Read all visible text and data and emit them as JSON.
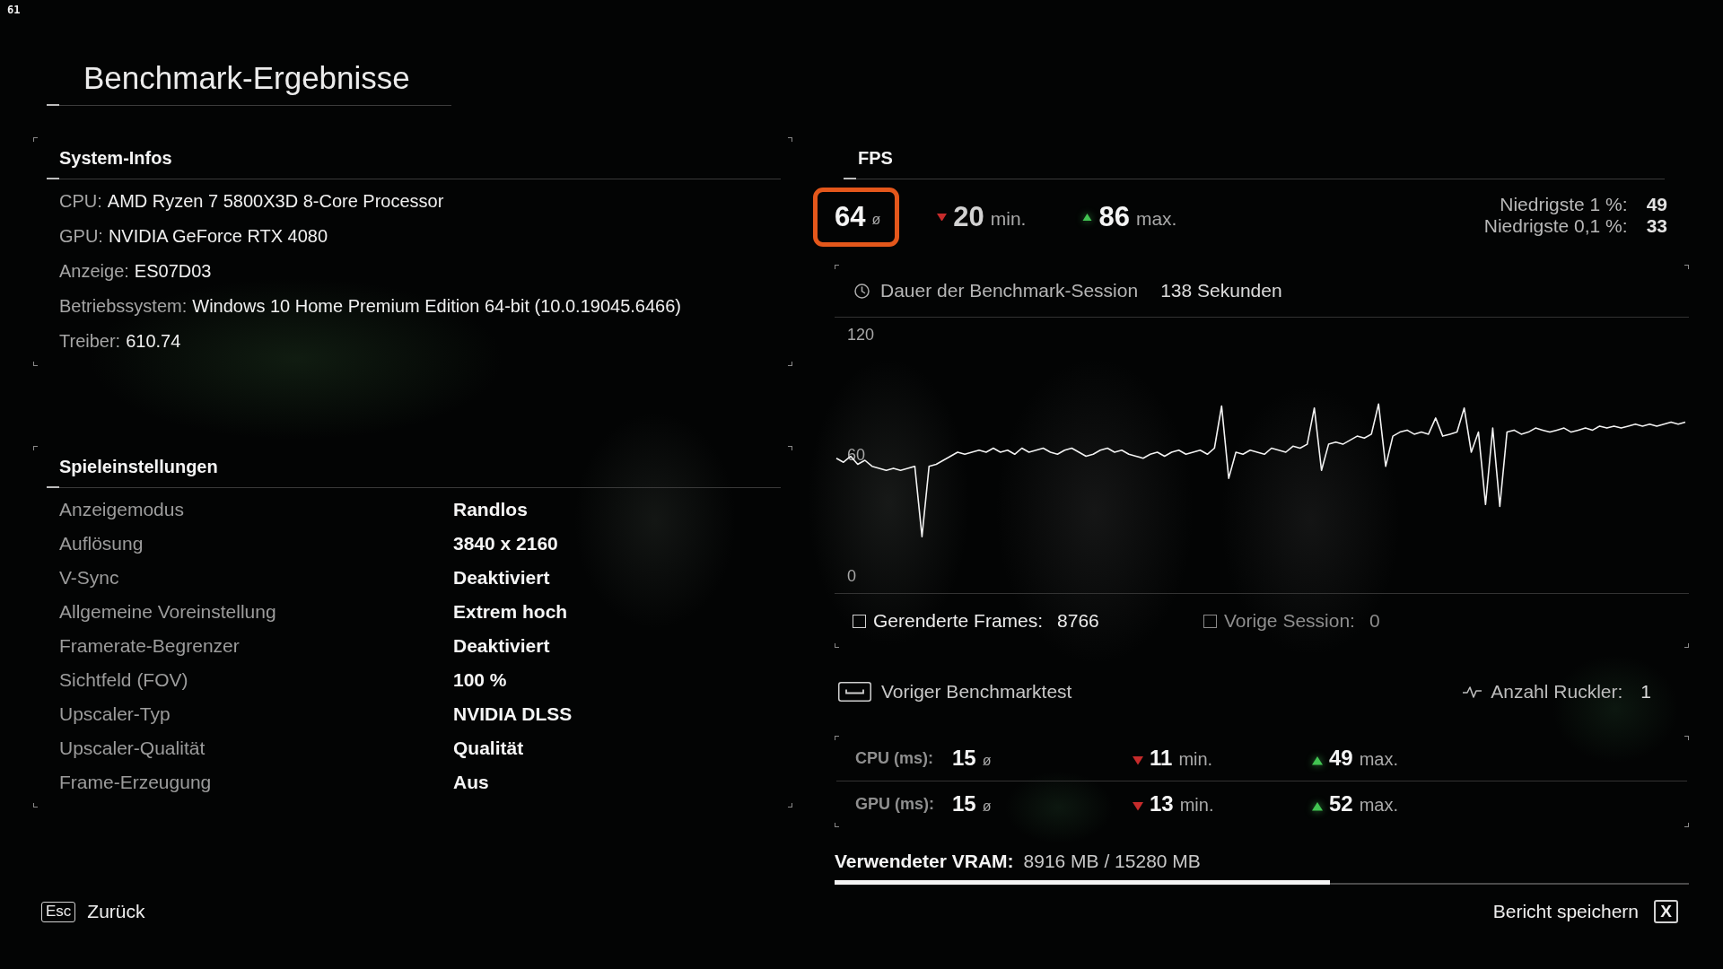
{
  "overlay_counter": "61",
  "title": "Benchmark-Ergebnisse",
  "system_info": {
    "heading": "System-Infos",
    "rows": [
      {
        "label": "CPU:",
        "value": "AMD Ryzen 7 5800X3D 8-Core Processor"
      },
      {
        "label": "GPU:",
        "value": "NVIDIA GeForce RTX 4080"
      },
      {
        "label": "Anzeige:",
        "value": "ES07D03"
      },
      {
        "label": "Betriebssystem:",
        "value": "Windows 10 Home Premium Edition 64-bit (10.0.19045.6466)"
      },
      {
        "label": "Treiber:",
        "value": "610.74"
      }
    ]
  },
  "game_settings": {
    "heading": "Spieleinstellungen",
    "rows": [
      {
        "label": "Anzeigemodus",
        "value": "Randlos"
      },
      {
        "label": "Auflösung",
        "value": "3840 x 2160"
      },
      {
        "label": "V-Sync",
        "value": "Deaktiviert"
      },
      {
        "label": "Allgemeine Voreinstellung",
        "value": "Extrem hoch"
      },
      {
        "label": "Framerate-Begrenzer",
        "value": "Deaktiviert"
      },
      {
        "label": "Sichtfeld (FOV)",
        "value": "100 %"
      },
      {
        "label": "Upscaler-Typ",
        "value": "NVIDIA DLSS"
      },
      {
        "label": "Upscaler-Qualität",
        "value": "Qualität"
      },
      {
        "label": "Frame-Erzeugung",
        "value": "Aus"
      }
    ]
  },
  "fps": {
    "heading": "FPS",
    "stats": [
      {
        "kind": "avg",
        "value": "64",
        "unit": "ø",
        "highlighted": true
      },
      {
        "kind": "min",
        "value": "20",
        "unit": "min.",
        "highlighted": false
      },
      {
        "kind": "max",
        "value": "86",
        "unit": "max.",
        "highlighted": false
      }
    ],
    "lows": [
      {
        "label": "Niedrigste 1 %:",
        "value": "49"
      },
      {
        "label": "Niedrigste 0,1 %:",
        "value": "33"
      }
    ],
    "session": {
      "label": "Dauer der Benchmark-Session",
      "value": "138 Sekunden"
    },
    "chart_data": {
      "type": "line",
      "categories": [
        null,
        null,
        null,
        null,
        null,
        null,
        null,
        null,
        null,
        null,
        null,
        null,
        null,
        null,
        null,
        null,
        null,
        null,
        null,
        null,
        null,
        null,
        null,
        null,
        null,
        null,
        null,
        null,
        null,
        null,
        null,
        null,
        null,
        null,
        null,
        null,
        null,
        null,
        null,
        null,
        null,
        null,
        null,
        null,
        null,
        null,
        null,
        null,
        null,
        null,
        null,
        null,
        null,
        null,
        null,
        null,
        null,
        null,
        null,
        null,
        null,
        null,
        null,
        null,
        null,
        null,
        null,
        null,
        null,
        null,
        null,
        null,
        null,
        null,
        null,
        null,
        null,
        null,
        null,
        null,
        null,
        null,
        null,
        null,
        null,
        null,
        null,
        null,
        null,
        null,
        null,
        null,
        null,
        null,
        null,
        null,
        null,
        null,
        null,
        null,
        null,
        null,
        null,
        null,
        null,
        null,
        null,
        null,
        null,
        null,
        null,
        null,
        null,
        null,
        null,
        null,
        null,
        null,
        null,
        null
      ],
      "ylim": [
        -35.3,
        155.3
      ],
      "yticks": [
        0,
        60,
        120
      ],
      "series": [
        {
          "color": "#f2f2f2",
          "values": [
            59,
            57,
            60,
            56,
            58,
            55,
            54,
            53,
            54,
            53,
            54,
            55,
            20,
            55,
            56,
            58,
            60,
            62,
            61,
            62,
            63,
            62,
            64,
            62,
            63,
            61,
            64,
            62,
            63,
            64,
            62,
            61,
            63,
            64,
            62,
            60,
            61,
            63,
            64,
            62,
            63,
            61,
            60,
            59,
            61,
            62,
            60,
            62,
            63,
            61,
            62,
            63,
            61,
            64,
            85,
            49,
            62,
            61,
            63,
            62,
            61,
            64,
            63,
            62,
            65,
            64,
            66,
            84,
            53,
            66,
            67,
            66,
            68,
            70,
            69,
            71,
            86,
            55,
            70,
            72,
            73,
            71,
            72,
            71,
            79,
            70,
            71,
            72,
            84,
            62,
            72,
            36,
            74,
            35,
            72,
            73,
            71,
            72,
            74,
            73,
            72,
            73,
            74,
            72,
            73,
            74,
            73,
            75,
            74,
            75,
            74,
            75,
            76,
            75,
            76,
            75,
            76,
            77,
            76,
            77
          ]
        }
      ]
    },
    "legend": [
      {
        "label": "Gerenderte Frames:",
        "value": "8766",
        "checked": false,
        "disabled": false
      },
      {
        "label": "Vorige Session:",
        "value": "0",
        "checked": false,
        "disabled": true
      }
    ]
  },
  "previous_benchmark": {
    "label": "Voriger Benchmarktest"
  },
  "stutter": {
    "label": "Anzahl Ruckler:",
    "value": "1"
  },
  "frame_times": [
    {
      "label": "CPU (ms):",
      "stats": [
        {
          "kind": "avg",
          "value": "15",
          "unit": "ø"
        },
        {
          "kind": "min",
          "value": "11",
          "unit": "min."
        },
        {
          "kind": "max",
          "value": "49",
          "unit": "max."
        }
      ]
    },
    {
      "label": "GPU (ms):",
      "stats": [
        {
          "kind": "avg",
          "value": "15",
          "unit": "ø"
        },
        {
          "kind": "min",
          "value": "13",
          "unit": "min."
        },
        {
          "kind": "max",
          "value": "52",
          "unit": "max."
        }
      ]
    }
  ],
  "vram": {
    "label": "Verwendeter VRAM:",
    "value": "8916 MB / 15280 MB",
    "level": 0.58
  },
  "footer": {
    "back": {
      "key": "Esc",
      "label": "Zurück"
    },
    "save": {
      "label": "Bericht speichern",
      "key": "X"
    }
  }
}
